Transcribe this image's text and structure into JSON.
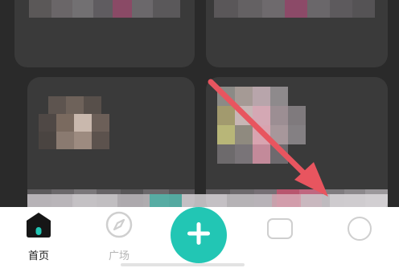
{
  "tabs": {
    "home": {
      "label": "首页",
      "icon": "home-icon",
      "active": true
    },
    "plaza": {
      "label": "广场",
      "icon": "compass-icon",
      "active": false
    },
    "add": {
      "icon": "plus-icon"
    },
    "hidden_tab_1": {
      "icon": "message-icon"
    },
    "hidden_tab_2": {
      "icon": "profile-icon"
    }
  },
  "annotation": {
    "icon": "red-arrow-icon",
    "color": "#e8555f"
  },
  "colors": {
    "background": "#2a2a2a",
    "card": "#3a3a3a",
    "tabbar": "#ffffff",
    "accent": "#22c6b4",
    "active_text": "#1a1a1a",
    "inactive_text": "#b5b5b5"
  }
}
